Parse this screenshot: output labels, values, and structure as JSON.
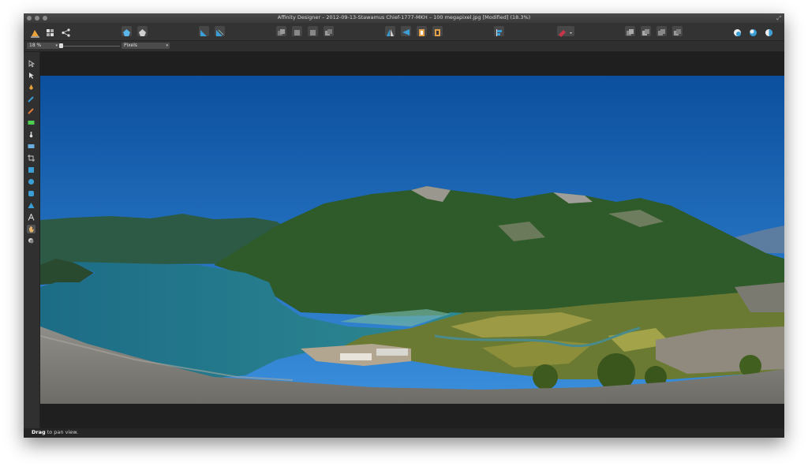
{
  "window": {
    "title": "Affinity Designer – 2012-09-13-Stawamus Chief-1777-MKH – 100 megapixel.jpg [Modified] (18.3%)"
  },
  "context_bar": {
    "zoom_value": "18 %",
    "units_value": "Pixels"
  },
  "toolbar": {
    "icons": [
      "designer-persona-icon",
      "pixel-persona-icon",
      "share-icon",
      "gallery-icon",
      "symbols-icon",
      "snapping-icon",
      "snapping-options-icon",
      "align-icon",
      "arrange-icon",
      "transform-icon",
      "flip-icon",
      "boolean-icon",
      "color-icon",
      "layers-icon",
      "effects-icon"
    ]
  },
  "tools": [
    "move",
    "node",
    "pen",
    "pencil",
    "brush",
    "fill",
    "fill-bucket",
    "transparency",
    "crop",
    "rectangle",
    "ellipse",
    "rounded-rect",
    "triangle",
    "text",
    "hand",
    "zoom"
  ],
  "status": {
    "bold": "Drag",
    "rest": " to pan view."
  },
  "colors": {
    "sky_top": "#0b4f9e",
    "sky_bottom": "#2f8be0",
    "water": "#1f6f86",
    "forest": "#2f5a2a",
    "rock": "#8e8c86"
  }
}
